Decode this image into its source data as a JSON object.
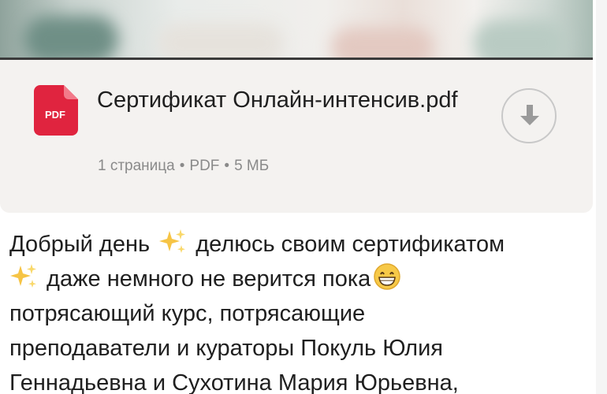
{
  "document": {
    "file_name": "Сертификат Онлайн-интенсив.pdf",
    "file_type_badge": "PDF",
    "pages": "1 страница",
    "type": "PDF",
    "size": "5 МБ",
    "separator": "•",
    "icon": "pdf-file-icon",
    "accent_color": "#e0243f"
  },
  "download": {
    "icon": "download-arrow-icon"
  },
  "message": {
    "segments": [
      "Добрый день ",
      " делюсь своим сертификатом",
      " даже немного не верится пока",
      "потрясающий курс, потрясающие",
      "преподаватели и кураторы Покуль Юлия",
      "Геннадьевна и Сухотина Мария Юрьевна,"
    ],
    "emojis": [
      "sparkles-emoji",
      "sparkles-emoji",
      "grinning-face-emoji"
    ]
  }
}
